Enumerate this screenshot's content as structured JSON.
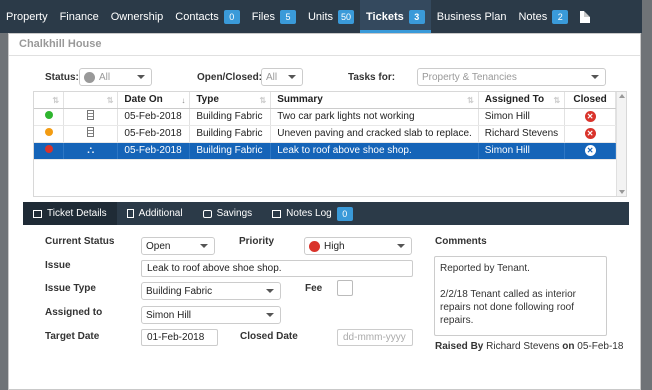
{
  "nav": {
    "items": [
      {
        "label": "Property",
        "badge": ""
      },
      {
        "label": "Finance",
        "badge": ""
      },
      {
        "label": "Ownership",
        "badge": ""
      },
      {
        "label": "Contacts",
        "badge": "0"
      },
      {
        "label": "Files",
        "badge": "5"
      },
      {
        "label": "Units",
        "badge": "50"
      },
      {
        "label": "Tickets",
        "badge": "3"
      },
      {
        "label": "Business Plan",
        "badge": ""
      },
      {
        "label": "Notes",
        "badge": "2"
      }
    ],
    "active": "Tickets",
    "doc_icon": "document-icon"
  },
  "panel": {
    "title": "Chalkhill House"
  },
  "filters": {
    "status_label": "Status:",
    "status_value": "All",
    "open_closed_label": "Open/Closed:",
    "open_closed_value": "All",
    "tasks_for_label": "Tasks for:",
    "tasks_for_value": "Property & Tenancies"
  },
  "table": {
    "columns": [
      "",
      "",
      "Date On",
      "Type",
      "Summary",
      "Assigned To",
      "Closed"
    ],
    "rows": [
      {
        "status_color": "#2fb52f",
        "icon": "building-icon",
        "date": "05-Feb-2018",
        "type": "Building Fabric",
        "summary": "Two car park lights not working",
        "assigned": "Simon Hill",
        "selected": false
      },
      {
        "status_color": "#f39c12",
        "icon": "building-icon",
        "date": "05-Feb-2018",
        "type": "Building Fabric",
        "summary": "Uneven paving and cracked slab to replace.",
        "assigned": "Richard Stevens",
        "selected": false
      },
      {
        "status_color": "#d9332b",
        "icon": "hierarchy-icon",
        "date": "05-Feb-2018",
        "type": "Building Fabric",
        "summary": "Leak to roof above shoe shop.",
        "assigned": "Simon Hill",
        "selected": true
      }
    ]
  },
  "tabs": [
    {
      "label": "Ticket Details",
      "badge": ""
    },
    {
      "label": "Additional",
      "badge": ""
    },
    {
      "label": "Savings",
      "badge": ""
    },
    {
      "label": "Notes Log",
      "badge": "0"
    }
  ],
  "form": {
    "current_status_label": "Current Status",
    "current_status_value": "Open",
    "priority_label": "Priority",
    "priority_value": "High",
    "issue_label": "Issue",
    "issue_value": "Leak to roof above shoe shop.",
    "issue_type_label": "Issue Type",
    "issue_type_value": "Building Fabric",
    "fee_label": "Fee",
    "assigned_to_label": "Assigned to",
    "assigned_to_value": "Simon Hill",
    "target_date_label": "Target Date",
    "target_date_value": "01-Feb-2018",
    "closed_date_label": "Closed Date",
    "closed_date_placeholder": "dd-mmm-yyyy",
    "comments_label": "Comments",
    "comments_line1": "Reported by Tenant.",
    "comments_line2": "2/2/18 Tenant called as interior repairs not done following roof repairs.",
    "raised_by_label": "Raised By",
    "raised_by_name": "Richard Stevens",
    "raised_on_label": "on",
    "raised_on_date": "05-Feb-18"
  },
  "colors": {
    "nav_bg": "#2b3a48",
    "accent": "#3a9ad9",
    "selected_row": "#1564b8",
    "priority_high": "#d9332b"
  }
}
